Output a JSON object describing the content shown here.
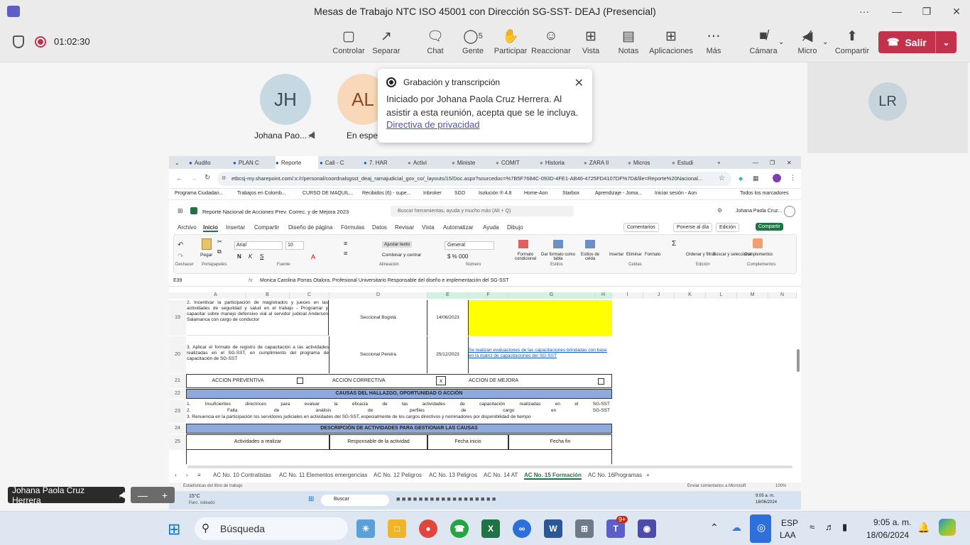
{
  "window": {
    "title": "Mesas de Trabajo NTC ISO 45001 con Dirección SG-SST- DEAJ (Presencial)",
    "more": "···",
    "minimize": "—",
    "maximize": "❐",
    "close": "✕"
  },
  "toolbar": {
    "timer": "01:02:30",
    "buttons": [
      {
        "label": "Controlar",
        "icon": "control-icon"
      },
      {
        "label": "Separar",
        "icon": "popout-icon"
      },
      {
        "label": "Chat",
        "icon": "chat-icon"
      },
      {
        "label": "Gente",
        "icon": "people-icon",
        "count": "5"
      },
      {
        "label": "Participar",
        "icon": "raise-hand-icon"
      },
      {
        "label": "Reaccionar",
        "icon": "react-icon"
      },
      {
        "label": "Vista",
        "icon": "view-icon"
      },
      {
        "label": "Notas",
        "icon": "notes-icon"
      },
      {
        "label": "Aplicaciones",
        "icon": "apps-icon"
      },
      {
        "label": "Más",
        "icon": "more-icon"
      },
      {
        "label": "Cámara",
        "icon": "camera-off-icon"
      },
      {
        "label": "Micro",
        "icon": "mic-off-icon"
      },
      {
        "label": "Compartir",
        "icon": "share-icon"
      }
    ],
    "leave": "Salir"
  },
  "participants": [
    {
      "initials": "JH",
      "name": "Johana Pao..."
    },
    {
      "initials": "AL",
      "name": "En esper"
    },
    {
      "initials": "LR",
      "name": ""
    }
  ],
  "popup": {
    "title": "Grabación y transcripción",
    "body": "Iniciado por Johana Paola Cruz Herrera. Al asistir a esta reunión, acepta que se le incluya.",
    "link": "Directiva de privacidad"
  },
  "browser": {
    "tabs": [
      "Audito",
      "PLAN C",
      "Reporte",
      "Cali - C",
      "7. HAR",
      "Activi",
      "Ministe",
      "COMIT",
      "Historia",
      "ZARA II",
      "Micros",
      "Estudi"
    ],
    "url": "etbcsj-my.sharepoint.com/:x:/r/personal/coordnalsgsst_deaj_ramajudicial_gov_co/_layouts/15/Doc.aspx?sourcedoc=%7B5F7684C-093D-4FE1-AB46-4725FD4107DF%7D&file=Reporte%20Nacional...",
    "bookmarks": [
      "Programa Ciudadan...",
      "Trabajos en Colomb...",
      "CURSO DE MAQUIL...",
      "Recibidos (6) - supe...",
      "Inbroker",
      "SGD",
      "Isolución ® 4.8",
      "Home-Aon",
      "Starbox",
      "Aprendizaje - Joma...",
      "Iniciar sesión - Aon"
    ],
    "bookmarks_all": "Todos los marcadores"
  },
  "excel": {
    "file": "Reporte Nacional de Acciones Prev. Correc. y de Mejora 2023",
    "search": "Buscar herramientas, ayuda y mucho más (Alt + Q)",
    "user": "Johana Paola Cruz...",
    "menus": [
      "Archivo",
      "Inicio",
      "Insertar",
      "Compartir",
      "Diseño de página",
      "Fórmulas",
      "Datos",
      "Revisar",
      "Vista",
      "Automatizar",
      "Ayuda",
      "Dibujo"
    ],
    "right_buttons": [
      "Comentarios",
      "Ponerse al día",
      "Edición",
      "Compartir"
    ],
    "ribbon": {
      "font": "Arial",
      "size": "10",
      "wrap": "Ajustar texto",
      "merge": "Combinar y centrar",
      "number_format": "General",
      "labels": [
        "Pegar",
        "Formato condicional",
        "Dar formato como tabla",
        "Estilos de celda",
        "Insertar",
        "Eliminar",
        "Formato",
        "Ordenar y filtrar",
        "Buscar y seleccionar",
        "Complementos"
      ],
      "groups": [
        "Deshacer",
        "Portapapeles",
        "Fuente",
        "Alineación",
        "Número",
        "Estilos",
        "Celdas",
        "Edición",
        "Complementos"
      ]
    },
    "namebox": "E39",
    "formula": "Monica Carolina Porras Otalora, Profesional Universitario Responsable del diseño e implementación del SG-SST",
    "columns": [
      "A",
      "B",
      "C",
      "D",
      "E",
      "F",
      "G",
      "H",
      "I",
      "J",
      "K",
      "L",
      "M",
      "N"
    ],
    "rows": {
      "r19": {
        "num": "19",
        "text": "2. Incentivar la participación de magistrados y jueces en las actividades de seguridad y salud en el trabajo - Programar y capacitar sobre manejo defensivo vial al servidor judicial Anderson Salamanca con cargo de conductor",
        "resp": "Seccional Bogotá",
        "date": "14/06/2023"
      },
      "r20": {
        "num": "20",
        "text": "3. Aplicar el formato de registro de capacitación a las actividades realizadas en el SG-SST, en cumplimiento del programa de capacitación de SG-SST",
        "resp": "Seccional Pereira",
        "date": "25/12/2023",
        "obs": "Se realizan evaluaciones de las capacitaciones brindadas con base en la matriz de capacitaciones del SG-SST"
      },
      "r21": {
        "num": "21",
        "prev": "ACCION PREVENTIVA",
        "corr": "ACCION CORRECTIVA",
        "corr_mark": "x",
        "mej": "ACCION DE MEJORA"
      },
      "r22": {
        "num": "22",
        "text": "CAUSAS DEL HALLAZGO, OPORTUNIDAD O ACCIÓN"
      },
      "r23": {
        "num": "23",
        "lines": [
          "1. Insuficientes directrices para evaluar la eficacia de las actividades de capacitación realizadas en el SG-SST",
          "2. Falta de análisis de perfiles de cargo en SG-SST",
          "3. Renuencia en la participación los servidores judiciales en actividades del SG-SST, especialmente de los cargos directivos y nominadores por disponibilidad de tiempo"
        ]
      },
      "r24": {
        "num": "24",
        "text": "DESCRIPCIÓN DE ACTIVIDADES PARA GESTIONAR LAS CAUSAS"
      },
      "r25": {
        "num": "25",
        "cols": [
          "Actividades a realizar",
          "Responsable de la actividad",
          "Fecha inicio",
          "Fecha fin"
        ]
      }
    },
    "sheets": [
      "AC No. 10 Contratistas",
      "AC No. 11 Elementos emergencias",
      "AC No. 12 Peligros",
      "AC No. 13 Peligros",
      "AC No. 14 AT",
      "AC No. 15 Formación",
      "AC No. 16Programas S"
    ],
    "status_left": "Estadísticas del libro de trabajo",
    "status_right": "Enviar comentarios a Microsoft",
    "zoom": "100%"
  },
  "inner_taskbar": {
    "weather": "15°C",
    "weather_sub": "Parc. soleado",
    "search": "Buscar",
    "time": "9:05 a. m.",
    "date": "18/06/2024"
  },
  "self_view": {
    "name": "Johana Paola Cruz Herrera"
  },
  "taskbar": {
    "search": "Búsqueda",
    "lang": "ESP",
    "lang_sub": "LAA",
    "time": "9:05 a. m.",
    "date": "18/06/2024",
    "badge": "9+"
  }
}
